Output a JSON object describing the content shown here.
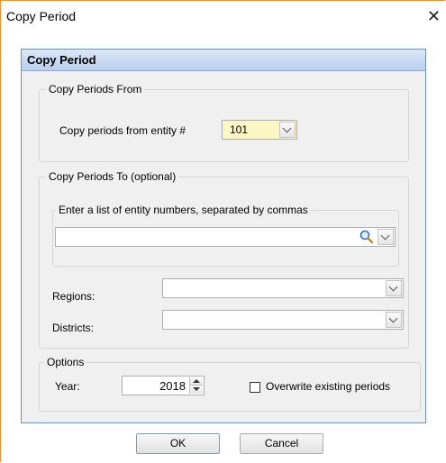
{
  "window": {
    "title": "Copy Period"
  },
  "panel": {
    "title": "Copy Period"
  },
  "copy_from": {
    "legend": "Copy Periods From",
    "label": "Copy periods from entity #",
    "entity_value": "101"
  },
  "copy_to": {
    "legend": "Copy Periods To (optional)",
    "entities": {
      "legend": "Enter a list of entity numbers, separated by commas",
      "value": ""
    },
    "regions_label": "Regions:",
    "regions_value": "",
    "districts_label": "Districts:",
    "districts_value": ""
  },
  "options": {
    "legend": "Options",
    "year_label": "Year:",
    "year_value": "2018",
    "overwrite_label": "Overwrite existing periods",
    "overwrite_checked": false
  },
  "buttons": {
    "ok": "OK",
    "cancel": "Cancel"
  },
  "colors": {
    "accent_border": "#e8952b",
    "header_blue": "#b9d0ee",
    "entity_highlight": "#fdf7c3"
  },
  "icons": [
    "close-icon",
    "search-icon",
    "chevron-down-icon",
    "spin-up-icon",
    "spin-down-icon"
  ]
}
